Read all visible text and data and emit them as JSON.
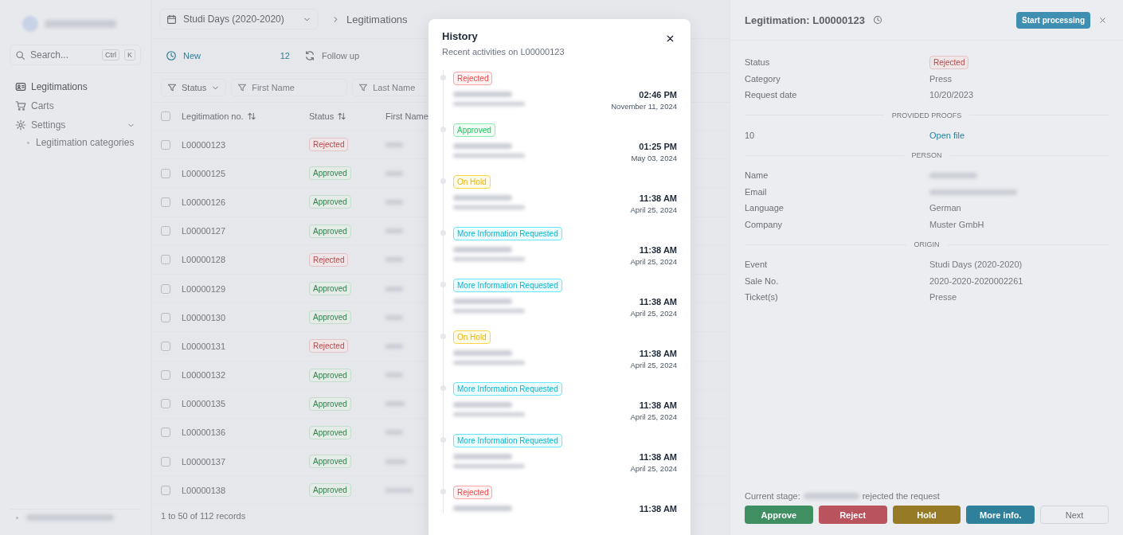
{
  "sidebar": {
    "search": {
      "placeholder": "Search...",
      "keys": [
        "Ctrl",
        "K"
      ]
    },
    "items": [
      {
        "label": "Legitimations",
        "selected": true
      },
      {
        "label": "Carts",
        "selected": false
      },
      {
        "label": "Settings",
        "selected": false,
        "expanded": true,
        "children": [
          {
            "label": "Legitimation categories",
            "selected": false
          }
        ]
      }
    ]
  },
  "header": {
    "event": "Studi Days (2020-2020)",
    "breadcrumb": "Legitimations"
  },
  "queues": [
    {
      "label": "New",
      "count": "12",
      "selected": true
    },
    {
      "label": "Follow up",
      "selected": false
    }
  ],
  "filters": [
    {
      "kind": "select",
      "label": "Status"
    },
    {
      "kind": "text",
      "placeholder": "First Name"
    },
    {
      "kind": "text",
      "placeholder": "Last Name"
    }
  ],
  "table": {
    "all_checked": false,
    "columns": [
      "Legitimation no.",
      "Status",
      "First Name"
    ],
    "rows": [
      {
        "checked": false,
        "number": "L00000123",
        "status": {
          "label": "Rejected",
          "kind": "rejected"
        }
      },
      {
        "checked": false,
        "number": "L00000125",
        "status": {
          "label": "Approved",
          "kind": "approved"
        }
      },
      {
        "checked": false,
        "number": "L00000126",
        "status": {
          "label": "Approved",
          "kind": "approved"
        }
      },
      {
        "checked": false,
        "number": "L00000127",
        "status": {
          "label": "Approved",
          "kind": "approved"
        }
      },
      {
        "checked": false,
        "number": "L00000128",
        "status": {
          "label": "Rejected",
          "kind": "rejected"
        }
      },
      {
        "checked": false,
        "number": "L00000129",
        "status": {
          "label": "Approved",
          "kind": "approved"
        }
      },
      {
        "checked": false,
        "number": "L00000130",
        "status": {
          "label": "Approved",
          "kind": "approved"
        }
      },
      {
        "checked": false,
        "number": "L00000131",
        "status": {
          "label": "Rejected",
          "kind": "rejected"
        }
      },
      {
        "checked": false,
        "number": "L00000132",
        "status": {
          "label": "Approved",
          "kind": "approved"
        }
      },
      {
        "checked": false,
        "number": "L00000135",
        "status": {
          "label": "Approved",
          "kind": "approved"
        }
      },
      {
        "checked": false,
        "number": "L00000136",
        "status": {
          "label": "Approved",
          "kind": "approved"
        }
      },
      {
        "checked": false,
        "number": "L00000137",
        "status": {
          "label": "Approved",
          "kind": "approved"
        }
      },
      {
        "checked": false,
        "number": "L00000138",
        "status": {
          "label": "Approved",
          "kind": "approved"
        }
      }
    ],
    "footer": "1 to 50 of 112 records"
  },
  "history": {
    "title": "History",
    "subtitle": "Recent activities on L00000123",
    "entries": [
      {
        "status": {
          "label": "Rejected",
          "kind": "rejected"
        },
        "time": "02:46 PM",
        "date": "November 11, 2024"
      },
      {
        "status": {
          "label": "Approved",
          "kind": "approved"
        },
        "time": "01:25 PM",
        "date": "May 03, 2024"
      },
      {
        "status": {
          "label": "On Hold",
          "kind": "hold"
        },
        "time": "11:38 AM",
        "date": "April 25, 2024"
      },
      {
        "status": {
          "label": "More Information Requested",
          "kind": "info"
        },
        "time": "11:38 AM",
        "date": "April 25, 2024"
      },
      {
        "status": {
          "label": "More Information Requested",
          "kind": "info"
        },
        "time": "11:38 AM",
        "date": "April 25, 2024"
      },
      {
        "status": {
          "label": "On Hold",
          "kind": "hold"
        },
        "time": "11:38 AM",
        "date": "April 25, 2024"
      },
      {
        "status": {
          "label": "More Information Requested",
          "kind": "info"
        },
        "time": "11:38 AM",
        "date": "April 25, 2024"
      },
      {
        "status": {
          "label": "More Information Requested",
          "kind": "info"
        },
        "time": "11:38 AM",
        "date": "April 25, 2024"
      },
      {
        "status": {
          "label": "Rejected",
          "kind": "rejected"
        },
        "time": "11:38 AM"
      }
    ]
  },
  "detail": {
    "title": "Legitimation: L00000123",
    "action": "Start processing",
    "summary": [
      {
        "label": "Status",
        "kind": "badge",
        "value": {
          "label": "Rejected",
          "kind": "rejected"
        }
      },
      {
        "label": "Category",
        "kind": "text",
        "value": "Press"
      },
      {
        "label": "Request date",
        "kind": "text",
        "value": "10/20/2023"
      }
    ],
    "sections": [
      {
        "heading": "PROVIDED PROOFS",
        "rows": [
          {
            "label": "10",
            "kind": "link",
            "value": "Open file"
          }
        ]
      },
      {
        "heading": "PERSON",
        "rows": [
          {
            "label": "Name",
            "kind": "blurred"
          },
          {
            "label": "Email",
            "kind": "blurred"
          },
          {
            "label": "Language",
            "kind": "text",
            "value": "German"
          },
          {
            "label": "Company",
            "kind": "text",
            "value": "Muster GmbH"
          }
        ]
      },
      {
        "heading": "ORIGIN",
        "rows": [
          {
            "label": "Event",
            "kind": "text",
            "value": "Studi Days (2020-2020)"
          },
          {
            "label": "Sale No.",
            "kind": "text",
            "value": "2020-2020-2020002261"
          },
          {
            "label": "Ticket(s)",
            "kind": "text",
            "value": "Presse"
          }
        ]
      }
    ],
    "stage": {
      "prefix": "Current stage:",
      "suffix": "rejected the request"
    },
    "buttons": [
      {
        "label": "Approve",
        "kind": "approve"
      },
      {
        "label": "Reject",
        "kind": "reject"
      },
      {
        "label": "Hold",
        "kind": "hold"
      },
      {
        "label": "More info.",
        "kind": "info"
      },
      {
        "label": "Next",
        "kind": "plain"
      }
    ]
  }
}
